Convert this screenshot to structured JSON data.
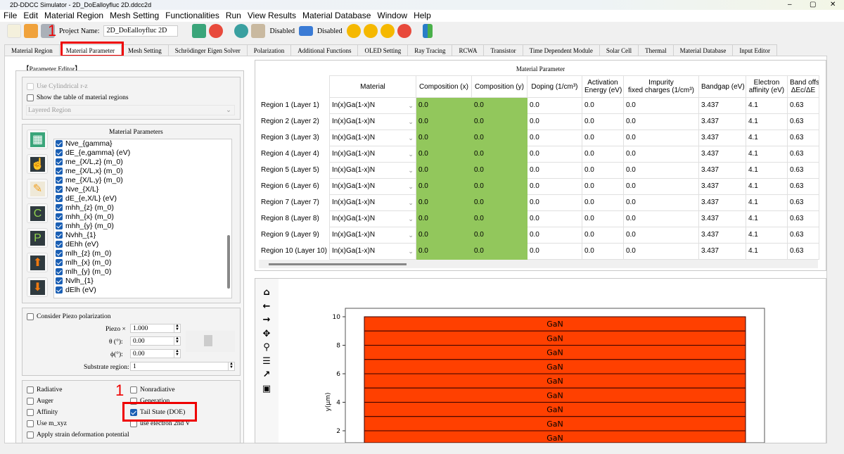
{
  "window": {
    "title": "2D-DDCC Simulator - 2D_DoEalloyfluc 2D.ddcc2d",
    "minimize": "–",
    "maximize": "▢",
    "close": "✕"
  },
  "menu": [
    "File",
    "Edit",
    "Material Region",
    "Mesh Setting",
    "Functionalities",
    "Run",
    "View Results",
    "Material Database",
    "Window",
    "Help"
  ],
  "toolbar": {
    "project_label": "Project Name:",
    "project_name": "2D_DoEalloyfluc 2D",
    "disabled1": "Disabled",
    "disabled2": "Disabled"
  },
  "tabs": [
    "Material Region",
    "Material Parameter",
    "Mesh Setting",
    "Schrödinger Eigen Solver",
    "Polarization",
    "Additional Functions",
    "OLED Setting",
    "Ray Tracing",
    "RCWA",
    "Transistor",
    "Time Dependent Module",
    "Solar Cell",
    "Thermal",
    "Material Database",
    "Input Editor"
  ],
  "active_tab": "Material Parameter",
  "annotations": {
    "step_tab": "1",
    "step_checkbox": "1",
    "color": "#e00000"
  },
  "editor": {
    "title": "【Parameter Editor】",
    "use_cylindrical": "Use Cylindrical r-z",
    "show_table": "Show the table of material regions",
    "region_select": "Layered Region",
    "params_title": "Material Parameters",
    "params": [
      "Nve_{gamma}",
      "dE_{e,gamma} (eV)",
      "me_{X/L,z} (m_0)",
      "me_{X/L,x} (m_0)",
      "me_{X/L,y} (m_0)",
      "Nve_{X/L}",
      "dE_{e,X/L} (eV)",
      "mhh_{z} (m_0)",
      "mhh_{x} (m_0)",
      "mhh_{y} (m_0)",
      "Nvhh_{1}",
      "dEhh (eV)",
      "mlh_{z} (m_0)",
      "mlh_{x} (m_0)",
      "mlh_{y} (m_0)",
      "Nvlh_{1}",
      "dElh (eV)"
    ],
    "side_buttons": [
      "table-import",
      "hand-pointer",
      "pencil",
      "C",
      "P",
      "arrow-up",
      "arrow-down"
    ],
    "piezo_label": "Consider Piezo polarization",
    "piezo_x_label": "Piezo ×",
    "piezo_x": "1.000",
    "theta_label": "θ (°):",
    "theta": "0.00",
    "phi_label": "ϕ(°):",
    "phi": "0.00",
    "substrate_label": "Substrate region:",
    "substrate": "1",
    "options": [
      {
        "label": "Radiative",
        "checked": false
      },
      {
        "label": "Nonradiative",
        "checked": false
      },
      {
        "label": "Auger",
        "checked": false
      },
      {
        "label": "Generation",
        "checked": false
      },
      {
        "label": "Affinity",
        "checked": false
      },
      {
        "label": "Tail State (DOE)",
        "checked": true
      },
      {
        "label": "Use m_xyz",
        "checked": false
      },
      {
        "label": "use electron 2nd V",
        "checked": false
      },
      {
        "label": "Apply strain deformation potential",
        "checked": false
      }
    ]
  },
  "table": {
    "title": "Material Parameter",
    "headers": [
      "Material",
      "Composition (x)",
      "Composition (y)",
      "Doping (1/cm³)",
      "Activation\nEnergy (eV)",
      "Impurity\nfixed charges (1/cm³)",
      "Bandgap (eV)",
      "Electron\naffinity (eV)",
      "Band offs\nΔEc/ΔE"
    ],
    "rows": [
      {
        "label": "Region 1 (Layer 1)",
        "cells": [
          "In(x)Ga(1-x)N",
          "0.0",
          "0.0",
          "0.0",
          "0.0",
          "0.0",
          "3.437",
          "4.1",
          "0.63"
        ]
      },
      {
        "label": "Region 2 (Layer 2)",
        "cells": [
          "In(x)Ga(1-x)N",
          "0.0",
          "0.0",
          "0.0",
          "0.0",
          "0.0",
          "3.437",
          "4.1",
          "0.63"
        ]
      },
      {
        "label": "Region 3 (Layer 3)",
        "cells": [
          "In(x)Ga(1-x)N",
          "0.0",
          "0.0",
          "0.0",
          "0.0",
          "0.0",
          "3.437",
          "4.1",
          "0.63"
        ]
      },
      {
        "label": "Region 4 (Layer 4)",
        "cells": [
          "In(x)Ga(1-x)N",
          "0.0",
          "0.0",
          "0.0",
          "0.0",
          "0.0",
          "3.437",
          "4.1",
          "0.63"
        ]
      },
      {
        "label": "Region 5 (Layer 5)",
        "cells": [
          "In(x)Ga(1-x)N",
          "0.0",
          "0.0",
          "0.0",
          "0.0",
          "0.0",
          "3.437",
          "4.1",
          "0.63"
        ]
      },
      {
        "label": "Region 6 (Layer 6)",
        "cells": [
          "In(x)Ga(1-x)N",
          "0.0",
          "0.0",
          "0.0",
          "0.0",
          "0.0",
          "3.437",
          "4.1",
          "0.63"
        ]
      },
      {
        "label": "Region 7 (Layer 7)",
        "cells": [
          "In(x)Ga(1-x)N",
          "0.0",
          "0.0",
          "0.0",
          "0.0",
          "0.0",
          "3.437",
          "4.1",
          "0.63"
        ]
      },
      {
        "label": "Region 8 (Layer 8)",
        "cells": [
          "In(x)Ga(1-x)N",
          "0.0",
          "0.0",
          "0.0",
          "0.0",
          "0.0",
          "3.437",
          "4.1",
          "0.63"
        ]
      },
      {
        "label": "Region 9 (Layer 9)",
        "cells": [
          "In(x)Ga(1-x)N",
          "0.0",
          "0.0",
          "0.0",
          "0.0",
          "0.0",
          "3.437",
          "4.1",
          "0.63"
        ]
      },
      {
        "label": "Region 10 (Layer 10)",
        "cells": [
          "In(x)Ga(1-x)N",
          "0.0",
          "0.0",
          "0.0",
          "0.0",
          "0.0",
          "3.437",
          "4.1",
          "0.63"
        ]
      }
    ],
    "highlight_color": "#92c75c"
  },
  "plot": {
    "tools": [
      "home",
      "back",
      "forward",
      "pan",
      "zoom",
      "configure",
      "edit-curves",
      "save"
    ],
    "ylabel": "y(μm)",
    "yticks": [
      "2",
      "4",
      "6",
      "8",
      "10"
    ],
    "layers": [
      "GaN",
      "GaN",
      "GaN",
      "GaN",
      "GaN",
      "GaN",
      "GaN",
      "GaN",
      "GaN"
    ],
    "layer_color": "#ff4000",
    "layer_bounds": [
      [
        9,
        10
      ],
      [
        8,
        9
      ],
      [
        7,
        8
      ],
      [
        6,
        7
      ],
      [
        5,
        6
      ],
      [
        4,
        5
      ],
      [
        3,
        4
      ],
      [
        2,
        3
      ],
      [
        1,
        2
      ]
    ]
  }
}
